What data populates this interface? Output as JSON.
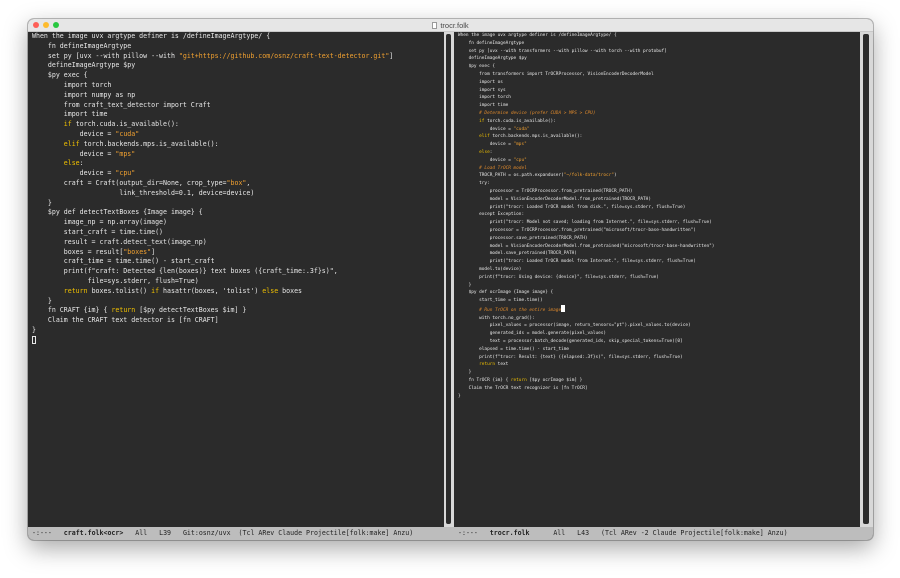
{
  "window": {
    "title": "trocr.folk"
  },
  "left_pane": {
    "lines": [
      [
        {
          "t": "When the image uvx argtype definer is /defineImageArgtype/ {"
        }
      ],
      [
        {
          "t": "    fn defineImageArgtype"
        }
      ],
      [
        {
          "t": ""
        }
      ],
      [
        {
          "t": "    set py [uvx --with pillow --with "
        },
        {
          "t": "\"git+https://github.com/osnz/craft-text-detector.git\"",
          "c": "str"
        },
        {
          "t": "]"
        }
      ],
      [
        {
          "t": "    defineImageArgtype $py"
        }
      ],
      [
        {
          "t": ""
        }
      ],
      [
        {
          "t": "    $py exec {"
        }
      ],
      [
        {
          "t": "        import torch"
        }
      ],
      [
        {
          "t": "        import numpy as np"
        }
      ],
      [
        {
          "t": "        from craft_text_detector import Craft"
        }
      ],
      [
        {
          "t": "        import time"
        }
      ],
      [
        {
          "t": ""
        }
      ],
      [
        {
          "t": "        "
        },
        {
          "t": "if",
          "c": "kw"
        },
        {
          "t": " torch.cuda.is_available():"
        }
      ],
      [
        {
          "t": "            device = "
        },
        {
          "t": "\"cuda\"",
          "c": "str"
        }
      ],
      [
        {
          "t": "        "
        },
        {
          "t": "elif",
          "c": "kw"
        },
        {
          "t": " torch.backends.mps.is_available():"
        }
      ],
      [
        {
          "t": "            device = "
        },
        {
          "t": "\"mps\"",
          "c": "str"
        }
      ],
      [
        {
          "t": "        "
        },
        {
          "t": "else",
          "c": "kw"
        },
        {
          "t": ":"
        }
      ],
      [
        {
          "t": "            device = "
        },
        {
          "t": "\"cpu\"",
          "c": "str"
        }
      ],
      [
        {
          "t": ""
        }
      ],
      [
        {
          "t": "        craft = Craft(output_dir=None, crop_type="
        },
        {
          "t": "\"box\"",
          "c": "str"
        },
        {
          "t": ","
        }
      ],
      [
        {
          "t": "                      link_threshold=0.1, device=device)"
        }
      ],
      [
        {
          "t": "    }"
        }
      ],
      [
        {
          "t": "    $py def detectTextBoxes {Image image} {"
        }
      ],
      [
        {
          "t": "        image_np = np.array(image)"
        }
      ],
      [
        {
          "t": ""
        }
      ],
      [
        {
          "t": "        start_craft = time.time()"
        }
      ],
      [
        {
          "t": "        result = craft.detect_text(image_np)"
        }
      ],
      [
        {
          "t": "        boxes = result["
        },
        {
          "t": "\"boxes\"",
          "c": "str"
        },
        {
          "t": "]"
        }
      ],
      [
        {
          "t": "        craft_time = time.time() - start_craft"
        }
      ],
      [
        {
          "t": ""
        }
      ],
      [
        {
          "t": "        print(f\"craft: Detected {len(boxes)} text boxes ({craft_time:.3f}s)\","
        }
      ],
      [
        {
          "t": "              file=sys.stderr, flush=True)"
        }
      ],
      [
        {
          "t": "        "
        },
        {
          "t": "return",
          "c": "kw"
        },
        {
          "t": " boxes.tolist() "
        },
        {
          "t": "if",
          "c": "kw"
        },
        {
          "t": " hasattr(boxes, 'tolist') "
        },
        {
          "t": "else",
          "c": "kw"
        },
        {
          "t": " boxes"
        }
      ],
      [
        {
          "t": "    }"
        }
      ],
      [
        {
          "t": ""
        }
      ],
      [
        {
          "t": "    fn CRAFT {im} { "
        },
        {
          "t": "return",
          "c": "kw"
        },
        {
          "t": " [$py detectTextBoxes $im] }"
        }
      ],
      [
        {
          "t": "    Claim the CRAFT text detector is [fn CRAFT]"
        }
      ],
      [
        {
          "t": "}"
        }
      ],
      [
        {
          "t": ""
        }
      ]
    ]
  },
  "right_pane": {
    "lines": [
      [
        {
          "t": "When the image uvx argtype definer is /defineImageArgtype/ {"
        }
      ],
      [
        {
          "t": "    fn defineImageArgtype"
        }
      ],
      [
        {
          "t": ""
        }
      ],
      [
        {
          "t": "    set py [uvx --with transformers --with pillow --with torch --with protobuf]"
        }
      ],
      [
        {
          "t": "    defineImageArgtype $py"
        }
      ],
      [
        {
          "t": ""
        }
      ],
      [
        {
          "t": "    $py exec {"
        }
      ],
      [
        {
          "t": "        from transformers import TrOCRProcessor, VisionEncoderDecoderModel"
        }
      ],
      [
        {
          "t": "        import os"
        }
      ],
      [
        {
          "t": "        import sys"
        }
      ],
      [
        {
          "t": "        import torch"
        }
      ],
      [
        {
          "t": "        import time"
        }
      ],
      [
        {
          "t": ""
        }
      ],
      [
        {
          "t": "        # Determine device (prefer CUDA > MPS > CPU)",
          "c": "cmt"
        }
      ],
      [
        {
          "t": "        "
        },
        {
          "t": "if",
          "c": "kw"
        },
        {
          "t": " torch.cuda.is_available():"
        }
      ],
      [
        {
          "t": "            device = "
        },
        {
          "t": "\"cuda\"",
          "c": "str"
        }
      ],
      [
        {
          "t": "        "
        },
        {
          "t": "elif",
          "c": "kw"
        },
        {
          "t": " torch.backends.mps.is_available():"
        }
      ],
      [
        {
          "t": "            device = "
        },
        {
          "t": "\"mps\"",
          "c": "str"
        }
      ],
      [
        {
          "t": "        "
        },
        {
          "t": "else",
          "c": "kw"
        },
        {
          "t": ":"
        }
      ],
      [
        {
          "t": "            device = "
        },
        {
          "t": "\"cpu\"",
          "c": "str"
        }
      ],
      [
        {
          "t": ""
        }
      ],
      [
        {
          "t": "        # Load TrOCR model",
          "c": "cmt"
        }
      ],
      [
        {
          "t": "        TROCR_PATH = os.path.expanduser("
        },
        {
          "t": "\"~/folk-data/trocr\"",
          "c": "str"
        },
        {
          "t": ")"
        }
      ],
      [
        {
          "t": "        try:"
        }
      ],
      [
        {
          "t": "            processor = TrOCRProcessor.from_pretrained(TROCR_PATH)"
        }
      ],
      [
        {
          "t": "            model = VisionEncoderDecoderModel.from_pretrained(TROCR_PATH)"
        }
      ],
      [
        {
          "t": "            print(\"trocr: Loaded TrOCR model from disk.\", file=sys.stderr, flush=True)"
        }
      ],
      [
        {
          "t": "        except Exception:"
        }
      ],
      [
        {
          "t": "            print(\"trocr: Model not saved; loading from Internet.\", file=sys.stderr, flush=True)"
        }
      ],
      [
        {
          "t": "            processor = TrOCRProcessor.from_pretrained(\"microsoft/trocr-base-handwritten\")"
        }
      ],
      [
        {
          "t": "            processor.save_pretrained(TROCR_PATH)"
        }
      ],
      [
        {
          "t": "            model = VisionEncoderDecoderModel.from_pretrained(\"microsoft/trocr-base-handwritten\")"
        }
      ],
      [
        {
          "t": "            model.save_pretrained(TROCR_PATH)"
        }
      ],
      [
        {
          "t": "            print(\"trocr: Loaded TrOCR model from Internet.\", file=sys.stderr, flush=True)"
        }
      ],
      [
        {
          "t": ""
        }
      ],
      [
        {
          "t": "        model.to(device)"
        }
      ],
      [
        {
          "t": "        print(f\"trocr: Using device: {device}\", file=sys.stderr, flush=True)"
        }
      ],
      [
        {
          "t": "    }"
        }
      ],
      [
        {
          "t": ""
        }
      ],
      [
        {
          "t": "    $py def ocrImage {Image image} {"
        }
      ],
      [
        {
          "t": "        start_time = time.time()"
        }
      ],
      [
        {
          "t": ""
        }
      ],
      [
        {
          "t": "        # Run TrOCR on the entire image",
          "c": "cmt"
        },
        {
          "cursor": "block"
        }
      ],
      [
        {
          "t": "        with torch.no_grad():"
        }
      ],
      [
        {
          "t": "            pixel_values = processor(image, return_tensors=\"pt\").pixel_values.to(device)"
        }
      ],
      [
        {
          "t": "            generated_ids = model.generate(pixel_values)"
        }
      ],
      [
        {
          "t": "            text = processor.batch_decode(generated_ids, skip_special_tokens=True)[0]"
        }
      ],
      [
        {
          "t": ""
        }
      ],
      [
        {
          "t": "        elapsed = time.time() - start_time"
        }
      ],
      [
        {
          "t": "        print(f\"trocr: Result: {text} ({elapsed:.3f}s)\", file=sys.stderr, flush=True)"
        }
      ],
      [
        {
          "t": ""
        }
      ],
      [
        {
          "t": "        "
        },
        {
          "t": "return",
          "c": "kw"
        },
        {
          "t": " text"
        }
      ],
      [
        {
          "t": "    }"
        }
      ],
      [
        {
          "t": ""
        }
      ],
      [
        {
          "t": "    fn TrOCR {im} { "
        },
        {
          "t": "return",
          "c": "kw"
        },
        {
          "t": " [$py ocrImage $im] }"
        }
      ],
      [
        {
          "t": "    Claim the TrOCR text recognizer is [fn TrOCR]"
        }
      ],
      [
        {
          "t": "}"
        }
      ]
    ]
  },
  "modeline_left": {
    "status": "-:---",
    "buffer": "craft.folk<ocr>",
    "position": "All",
    "line": "L39",
    "vc": "Git:osnz/uvx",
    "modes": "(Tcl ARev Claude Projectile[folk:make] Anzu)"
  },
  "modeline_right": {
    "status": "-:---",
    "buffer": "trocr.folk",
    "position": "All",
    "line": "L43",
    "modes": "(Tcl ARev -2 Claude Projectile[folk:make] Anzu)"
  },
  "colors": {
    "background": "#2b2b2b",
    "text": "#e8e8e8",
    "keyword": "#f0c000",
    "string": "#f0a030",
    "comment": "#e08a2c",
    "modeline": "#bdbdbd"
  }
}
